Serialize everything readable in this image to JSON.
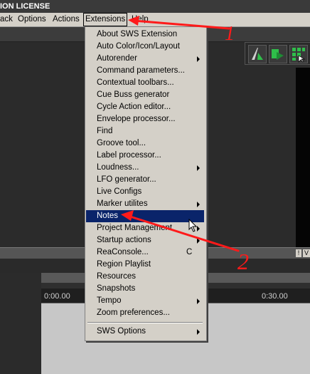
{
  "window": {
    "title": "ION LICENSE"
  },
  "menubar": {
    "items": [
      {
        "label": "ack"
      },
      {
        "label": "Options"
      },
      {
        "label": "Actions"
      },
      {
        "label": "Extensions"
      },
      {
        "label": "Help"
      }
    ]
  },
  "toolbar": {
    "icons": [
      "trim-tool-icon",
      "item-tool-icon",
      "grid-tool-icon"
    ]
  },
  "ruler": {
    "labels": [
      "0:00.00",
      "0:30.00"
    ]
  },
  "side_tabs": [
    "!",
    "V"
  ],
  "extensions_menu": {
    "items": [
      {
        "label": "About SWS Extension"
      },
      {
        "label": "Auto Color/Icon/Layout"
      },
      {
        "label": "Autorender",
        "submenu": true
      },
      {
        "label": "Command parameters..."
      },
      {
        "label": "Contextual toolbars..."
      },
      {
        "label": "Cue Buss generator"
      },
      {
        "label": "Cycle Action editor..."
      },
      {
        "label": "Envelope processor..."
      },
      {
        "label": "Find"
      },
      {
        "label": "Groove tool..."
      },
      {
        "label": "Label processor..."
      },
      {
        "label": "Loudness...",
        "submenu": true
      },
      {
        "label": "LFO generator..."
      },
      {
        "label": "Live Configs"
      },
      {
        "label": "Marker utilites",
        "submenu": true
      },
      {
        "label": "Notes",
        "highlighted": true
      },
      {
        "label": "Project Management",
        "submenu": true
      },
      {
        "label": "Startup actions",
        "submenu": true
      },
      {
        "label": "ReaConsole...",
        "shortcut": "C"
      },
      {
        "label": "Region Playlist"
      },
      {
        "label": "Resources"
      },
      {
        "label": "Snapshots"
      },
      {
        "label": "Tempo",
        "submenu": true
      },
      {
        "label": "Zoom preferences..."
      }
    ],
    "footer": {
      "label": "SWS Options",
      "submenu": true
    }
  },
  "annotations": {
    "color": "#ff1a1a",
    "labels": [
      "1",
      "2"
    ]
  }
}
